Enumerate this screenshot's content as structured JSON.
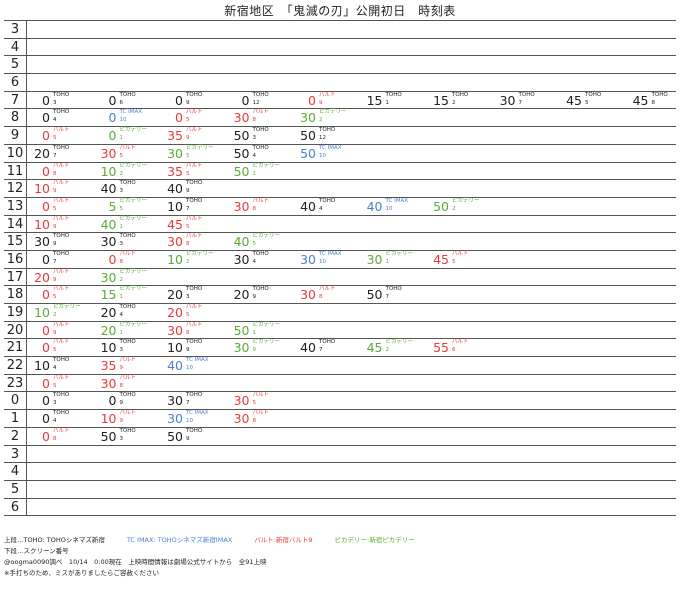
{
  "title": "新宿地区　「鬼滅の刃」公開初日　時刻表",
  "colors": {
    "TOHO": "#222222",
    "TC IMAX": "#4a7fd4",
    "バルト": "#e83a3a",
    "ピカデリー": "#5aaa3a"
  },
  "rows": [
    {
      "hour": "3",
      "entries": []
    },
    {
      "hour": "4",
      "entries": []
    },
    {
      "hour": "5",
      "entries": []
    },
    {
      "hour": "6",
      "entries": []
    },
    {
      "hour": "7",
      "entries": [
        {
          "min": "0",
          "theater": "TOHO",
          "screen": "3"
        },
        {
          "min": "0",
          "theater": "TOHO",
          "screen": "6"
        },
        {
          "min": "0",
          "theater": "TOHO",
          "screen": "9"
        },
        {
          "min": "0",
          "theater": "TOHO",
          "screen": "12"
        },
        {
          "min": "0",
          "theater": "バルト",
          "screen": "9"
        },
        {
          "min": "15",
          "theater": "TOHO",
          "screen": "1"
        },
        {
          "min": "15",
          "theater": "TOHO",
          "screen": "2"
        },
        {
          "min": "30",
          "theater": "TOHO",
          "screen": "7"
        },
        {
          "min": "45",
          "theater": "TOHO",
          "screen": "5"
        },
        {
          "min": "45",
          "theater": "TOHO",
          "screen": "8"
        }
      ]
    },
    {
      "hour": "8",
      "entries": [
        {
          "min": "0",
          "theater": "TOHO",
          "screen": "4"
        },
        {
          "min": "0",
          "theater": "TC IMAX",
          "screen": "10"
        },
        {
          "min": "0",
          "theater": "バルト",
          "screen": "5"
        },
        {
          "min": "30",
          "theater": "バルト",
          "screen": "8"
        },
        {
          "min": "30",
          "theater": "ピカデリー",
          "screen": "2"
        }
      ]
    },
    {
      "hour": "9",
      "entries": [
        {
          "min": "0",
          "theater": "バルト",
          "screen": "5"
        },
        {
          "min": "0",
          "theater": "ピカデリー",
          "screen": "1"
        },
        {
          "min": "35",
          "theater": "バルト",
          "screen": "9"
        },
        {
          "min": "50",
          "theater": "TOHO",
          "screen": "3"
        },
        {
          "min": "50",
          "theater": "TOHO",
          "screen": "12"
        }
      ]
    },
    {
      "hour": "10",
      "entries": [
        {
          "min": "20",
          "theater": "TOHO",
          "screen": "7"
        },
        {
          "min": "30",
          "theater": "バルト",
          "screen": "5"
        },
        {
          "min": "30",
          "theater": "ピカデリー",
          "screen": "5"
        },
        {
          "min": "50",
          "theater": "TOHO",
          "screen": "4"
        },
        {
          "min": "50",
          "theater": "TC IMAX",
          "screen": "10"
        }
      ]
    },
    {
      "hour": "11",
      "entries": [
        {
          "min": "0",
          "theater": "バルト",
          "screen": "8"
        },
        {
          "min": "10",
          "theater": "ピカデリー",
          "screen": "2"
        },
        {
          "min": "35",
          "theater": "バルト",
          "screen": "5"
        },
        {
          "min": "50",
          "theater": "ピカデリー",
          "screen": "1"
        }
      ]
    },
    {
      "hour": "12",
      "entries": [
        {
          "min": "10",
          "theater": "バルト",
          "screen": "9"
        },
        {
          "min": "40",
          "theater": "TOHO",
          "screen": "3"
        },
        {
          "min": "40",
          "theater": "TOHO",
          "screen": "9"
        }
      ]
    },
    {
      "hour": "13",
      "entries": [
        {
          "min": "0",
          "theater": "バルト",
          "screen": "5"
        },
        {
          "min": "5",
          "theater": "ピカデリー",
          "screen": "5"
        },
        {
          "min": "10",
          "theater": "TOHO",
          "screen": "7"
        },
        {
          "min": "30",
          "theater": "バルト",
          "screen": "8"
        },
        {
          "min": "40",
          "theater": "TOHO",
          "screen": "4"
        },
        {
          "min": "40",
          "theater": "TC IMAX",
          "screen": "10"
        },
        {
          "min": "50",
          "theater": "ピカデリー",
          "screen": "2"
        }
      ]
    },
    {
      "hour": "14",
      "entries": [
        {
          "min": "10",
          "theater": "バルト",
          "screen": "9"
        },
        {
          "min": "40",
          "theater": "ピカデリー",
          "screen": "1"
        },
        {
          "min": "45",
          "theater": "バルト",
          "screen": "5"
        }
      ]
    },
    {
      "hour": "15",
      "entries": [
        {
          "min": "30",
          "theater": "TOHO",
          "screen": "9"
        },
        {
          "min": "30",
          "theater": "TOHO",
          "screen": "3"
        },
        {
          "min": "30",
          "theater": "バルト",
          "screen": "8"
        },
        {
          "min": "40",
          "theater": "ピカデリー",
          "screen": "5"
        }
      ]
    },
    {
      "hour": "16",
      "entries": [
        {
          "min": "0",
          "theater": "TOHO",
          "screen": "7"
        },
        {
          "min": "0",
          "theater": "バルト",
          "screen": "8"
        },
        {
          "min": "10",
          "theater": "ピカデリー",
          "screen": "2"
        },
        {
          "min": "30",
          "theater": "TOHO",
          "screen": "4"
        },
        {
          "min": "30",
          "theater": "TC IMAX",
          "screen": "10"
        },
        {
          "min": "30",
          "theater": "ピカデリー",
          "screen": "1"
        },
        {
          "min": "45",
          "theater": "バルト",
          "screen": "5"
        }
      ]
    },
    {
      "hour": "17",
      "entries": [
        {
          "min": "20",
          "theater": "バルト",
          "screen": "9"
        },
        {
          "min": "30",
          "theater": "ピカデリー",
          "screen": "2"
        }
      ]
    },
    {
      "hour": "18",
      "entries": [
        {
          "min": "0",
          "theater": "バルト",
          "screen": "5"
        },
        {
          "min": "15",
          "theater": "ピカデリー",
          "screen": "1"
        },
        {
          "min": "20",
          "theater": "TOHO",
          "screen": "3"
        },
        {
          "min": "20",
          "theater": "TOHO",
          "screen": "9"
        },
        {
          "min": "30",
          "theater": "バルト",
          "screen": "8"
        },
        {
          "min": "50",
          "theater": "TOHO",
          "screen": "7"
        }
      ]
    },
    {
      "hour": "19",
      "entries": [
        {
          "min": "10",
          "theater": "ピカデリー",
          "screen": "2"
        },
        {
          "min": "20",
          "theater": "TOHO",
          "screen": "4"
        },
        {
          "min": "20",
          "theater": "バルト",
          "screen": "5"
        }
      ]
    },
    {
      "hour": "20",
      "entries": [
        {
          "min": "0",
          "theater": "バルト",
          "screen": "9"
        },
        {
          "min": "20",
          "theater": "ピカデリー",
          "screen": "1"
        },
        {
          "min": "30",
          "theater": "バルト",
          "screen": "8"
        },
        {
          "min": "50",
          "theater": "ピカデリー",
          "screen": "1"
        }
      ]
    },
    {
      "hour": "21",
      "entries": [
        {
          "min": "0",
          "theater": "バルト",
          "screen": "5"
        },
        {
          "min": "10",
          "theater": "TOHO",
          "screen": "3"
        },
        {
          "min": "10",
          "theater": "TOHO",
          "screen": "9"
        },
        {
          "min": "30",
          "theater": "ピカデリー",
          "screen": "9"
        },
        {
          "min": "40",
          "theater": "TOHO",
          "screen": "7"
        },
        {
          "min": "45",
          "theater": "ピカデリー",
          "screen": "2"
        },
        {
          "min": "55",
          "theater": "バルト",
          "screen": "6"
        }
      ]
    },
    {
      "hour": "22",
      "entries": [
        {
          "min": "10",
          "theater": "TOHO",
          "screen": "4"
        },
        {
          "min": "35",
          "theater": "バルト",
          "screen": "9"
        },
        {
          "min": "40",
          "theater": "TC IMAX",
          "screen": "10"
        }
      ]
    },
    {
      "hour": "23",
      "entries": [
        {
          "min": "0",
          "theater": "バルト",
          "screen": "5"
        },
        {
          "min": "30",
          "theater": "バルト",
          "screen": "8"
        }
      ]
    },
    {
      "hour": "0",
      "entries": [
        {
          "min": "0",
          "theater": "TOHO",
          "screen": "3"
        },
        {
          "min": "0",
          "theater": "TOHO",
          "screen": "9"
        },
        {
          "min": "30",
          "theater": "TOHO",
          "screen": "7"
        },
        {
          "min": "30",
          "theater": "バルト",
          "screen": "5"
        }
      ]
    },
    {
      "hour": "1",
      "entries": [
        {
          "min": "0",
          "theater": "TOHO",
          "screen": "4"
        },
        {
          "min": "10",
          "theater": "バルト",
          "screen": "9"
        },
        {
          "min": "30",
          "theater": "TC IMAX",
          "screen": "10"
        },
        {
          "min": "30",
          "theater": "バルト",
          "screen": "8"
        }
      ]
    },
    {
      "hour": "2",
      "entries": [
        {
          "min": "0",
          "theater": "バルト",
          "screen": "8"
        },
        {
          "min": "50",
          "theater": "TOHO",
          "screen": "3"
        },
        {
          "min": "50",
          "theater": "TOHO",
          "screen": "9"
        }
      ]
    },
    {
      "hour": "3",
      "entries": []
    },
    {
      "hour": "4",
      "entries": []
    },
    {
      "hour": "5",
      "entries": []
    },
    {
      "hour": "6",
      "entries": []
    }
  ],
  "legend": [
    {
      "text": "上段…TOHO: TOHOシネマズ新宿",
      "theater": "TOHO"
    },
    {
      "text": "TC IMAX: TOHOシネマズ新宿IMAX",
      "theater": "TC IMAX"
    },
    {
      "text": "バルト:新宿バルト9",
      "theater": "バルト"
    },
    {
      "text": "ピカデリー:新宿ピカデリー",
      "theater": "ピカデリー"
    }
  ],
  "notes": [
    "下段…スクリーン番号",
    "@oogma0090調べ　10/14　0:00現在　上映時間情報は劇場公式サイトから　全91上映",
    "※手打ちのため、ミスがありましたらご容赦ください"
  ]
}
